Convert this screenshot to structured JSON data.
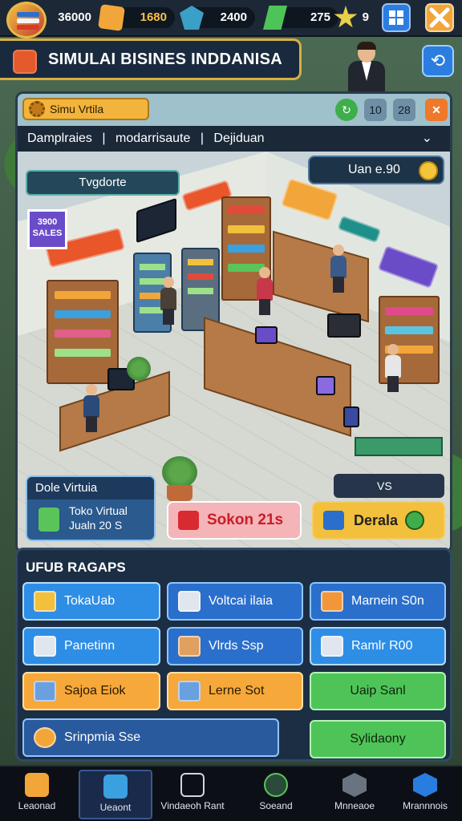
{
  "hud": {
    "money": "36000",
    "gold": "1680",
    "gems": "2400",
    "cash": "275",
    "stars": "9"
  },
  "title": "SIMULAI BISINES INDDANISA",
  "panel": {
    "tag_label": "Simu Vrtila",
    "header_buttons": [
      "10",
      "28"
    ],
    "tabs": [
      "Damplraies",
      "|",
      "modarrisaute",
      "|",
      "Dejiduan"
    ],
    "store_label": "Tvgdorte",
    "balance_label": "Uan e.90",
    "poster_text": "3900 SALES",
    "store_card": {
      "title": "Dole Virtuia",
      "line1": "Toko Virtual",
      "line2": "Jualn 20 S"
    },
    "mini_bar_text": "VS",
    "sale_button": "Sokon 21s",
    "deal_button": "Derala"
  },
  "upgrades": {
    "title": "UFUB RAGAPS",
    "buttons": [
      {
        "label": "TokaUab",
        "style": "blue"
      },
      {
        "label": "Voltcai ilaia",
        "style": "dblue"
      },
      {
        "label": "Marnein S0n",
        "style": "dblue"
      },
      {
        "label": "Panetinn",
        "style": "blue"
      },
      {
        "label": "Vlrds Ssp",
        "style": "dblue"
      },
      {
        "label": "Ramlr R00",
        "style": "blue"
      },
      {
        "label": "Sajoa Eiok",
        "style": "orange"
      },
      {
        "label": "Lerne Sot",
        "style": "orange"
      },
      {
        "label": "Uaip Sanl",
        "style": "green"
      },
      {
        "label": "Srinpmia Sse",
        "style": "dblue"
      },
      {
        "label": "Sylidaony",
        "style": "green"
      }
    ]
  },
  "nav": [
    "Leaonad",
    "Ueaont",
    "Vindaeoh Rant",
    "Soeand",
    "Mnneaoe",
    "Mrannnois"
  ],
  "colors": {
    "accent_gold": "#d8b040",
    "panel_dark": "#1c2e44",
    "button_blue": "#2e8ee6",
    "button_orange": "#f6a83a",
    "button_green": "#4ec458"
  }
}
